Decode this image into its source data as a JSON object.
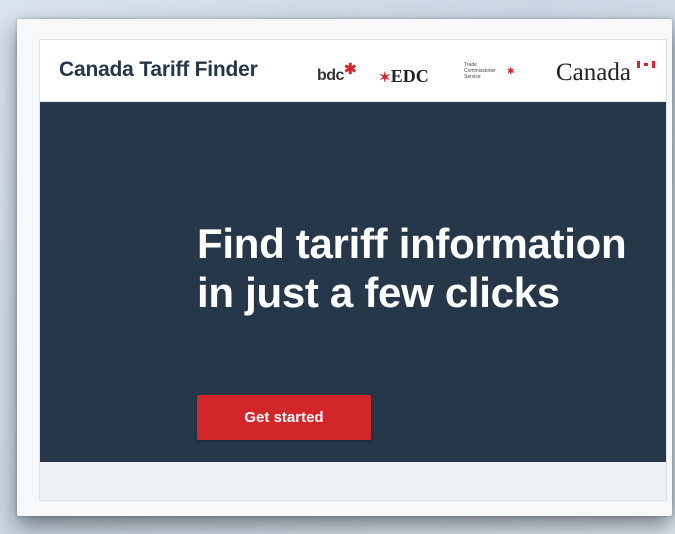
{
  "header": {
    "site_title": "Canada Tariff Finder",
    "partners": {
      "bdc": "bdc",
      "edc": "EDC",
      "tcs": [
        "Trade",
        "Commissioner",
        "Service"
      ],
      "wordmark": "Canada"
    }
  },
  "hero": {
    "heading": "Find tariff information in just a few clicks",
    "cta_label": "Get started"
  },
  "colors": {
    "header_text": "#26374a",
    "hero_background": "#26374a",
    "cta_background": "#d3262b"
  }
}
